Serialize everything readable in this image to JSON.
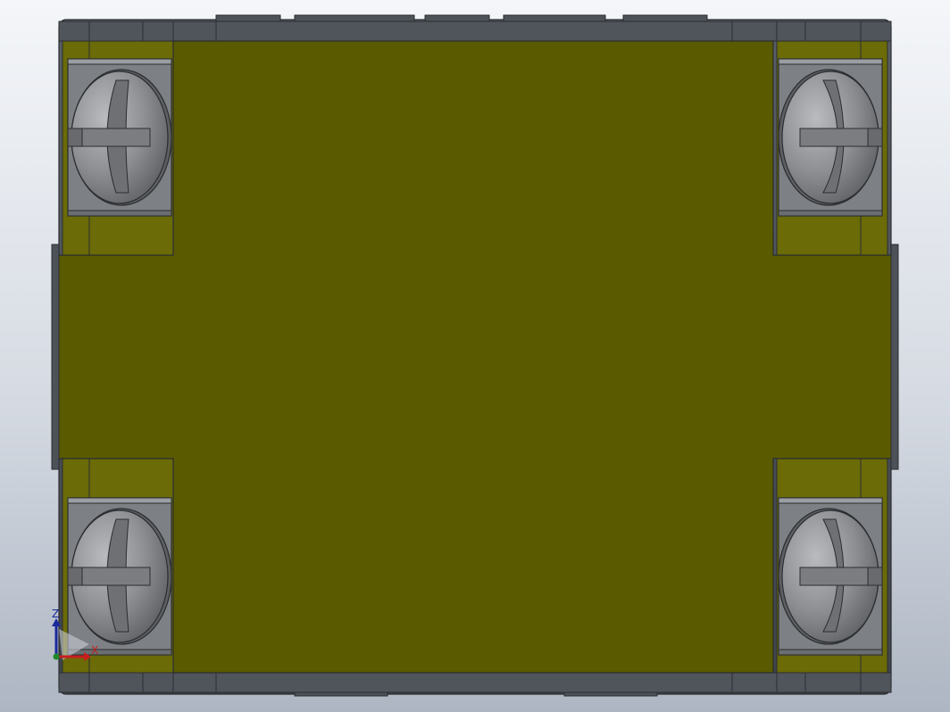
{
  "viewport": {
    "background_top": "#f4f6f9",
    "background_bottom": "#aeb6c3"
  },
  "model": {
    "body_color": "#5a5a00",
    "bracket_color": "#6b6b07",
    "bracket_inner_color": "#7a7a12",
    "frame_color": "#4a4f55",
    "terminal_block_color": "#7d8084",
    "screw_color": "#8a8c8f",
    "outline_color": "#2b2d30"
  },
  "screws": [
    {
      "name": "screw-top-left",
      "icon": "slotted-screw-icon"
    },
    {
      "name": "screw-top-right",
      "icon": "slotted-screw-icon"
    },
    {
      "name": "screw-bottom-left",
      "icon": "slotted-screw-icon"
    },
    {
      "name": "screw-bottom-right",
      "icon": "slotted-screw-icon"
    }
  ],
  "triad": {
    "z_label": "Z",
    "x_label": "X",
    "z_color": "#1a2a9a",
    "x_color": "#c81e1e",
    "y_color": "#1e8a2a"
  }
}
